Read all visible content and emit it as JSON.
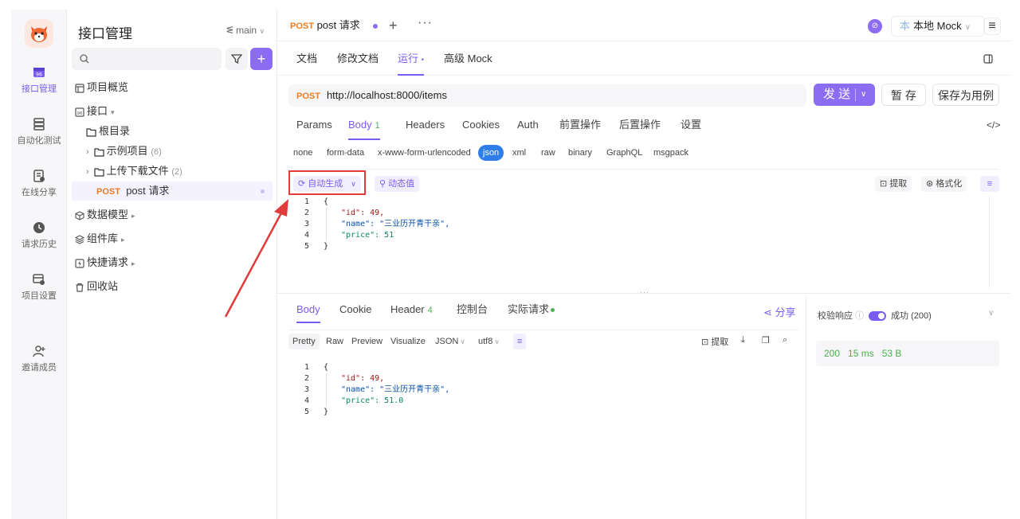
{
  "tree": {
    "title": "接口管理",
    "branch": "main",
    "items": [
      {
        "label": "项目概览"
      },
      {
        "label": "接口"
      },
      {
        "label": "根目录"
      },
      {
        "label": "示例项目",
        "count": "(6)"
      },
      {
        "label": "上传下载文件",
        "count": "(2)"
      },
      {
        "method": "POST",
        "label": "post 请求"
      },
      {
        "label": "数据模型"
      },
      {
        "label": "组件库"
      },
      {
        "label": "快捷请求"
      },
      {
        "label": "回收站"
      }
    ]
  },
  "rail": {
    "items": [
      {
        "label": "接口管理"
      },
      {
        "label": "自动化测试"
      },
      {
        "label": "在线分享"
      },
      {
        "label": "请求历史"
      },
      {
        "label": "项目设置"
      },
      {
        "label": "邀请成员"
      }
    ]
  },
  "tab": {
    "method": "POST",
    "label": "post 请求",
    "plus": "+",
    "more": "···"
  },
  "env": {
    "label": "本地 Mock",
    "star": "本"
  },
  "subtabs": [
    "文档",
    "修改文档",
    "运行",
    "高级 Mock"
  ],
  "request": {
    "method": "POST",
    "url": "http://localhost:8000/items",
    "send": "发 送",
    "save_draft": "暂 存",
    "save_case": "保存为用例"
  },
  "reqtabs": [
    {
      "label": "Params"
    },
    {
      "label": "Body",
      "badge": "1"
    },
    {
      "label": "Headers"
    },
    {
      "label": "Cookies"
    },
    {
      "label": "Auth"
    },
    {
      "label": "前置操作"
    },
    {
      "label": "后置操作"
    },
    {
      "label": "设置"
    }
  ],
  "body_types": [
    "none",
    "form-data",
    "x-www-form-urlencoded",
    "json",
    "xml",
    "raw",
    "binary",
    "GraphQL",
    "msgpack"
  ],
  "editor": {
    "auto_generate": "自动生成",
    "dynamic_value": "动态值",
    "extract": "提取",
    "format": "格式化",
    "lines": [
      "{",
      "\"id\": 49,",
      "\"name\": \"三业历开青干亲\",",
      "\"price\": 51",
      "}"
    ]
  },
  "response": {
    "tabs": [
      {
        "label": "Body"
      },
      {
        "label": "Cookie"
      },
      {
        "label": "Header",
        "badge": "4"
      },
      {
        "label": "控制台"
      },
      {
        "label": "实际请求"
      }
    ],
    "share": "分享",
    "formats": [
      "Pretty",
      "Raw",
      "Preview",
      "Visualize"
    ],
    "lang": "JSON",
    "charset": "utf8",
    "extract": "提取",
    "lines": [
      "{",
      "\"id\": 49,",
      "\"name\": \"三业历开青干亲\",",
      "\"price\": 51.0",
      "}"
    ]
  },
  "validation": {
    "label": "校验响应",
    "result": "成功 (200)",
    "status": "200",
    "time": "15 ms",
    "size": "53 B"
  },
  "colors": {
    "accent": "#7b5cf0",
    "post": "#f07c1d",
    "success": "#4caf50",
    "highlight_box": "#e23b3b"
  }
}
